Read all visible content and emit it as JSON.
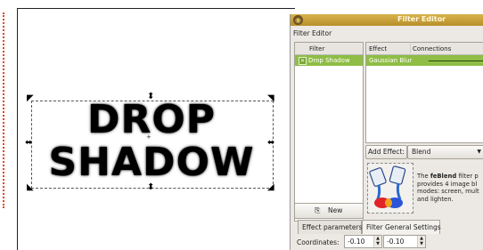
{
  "canvas": {
    "art_line1": "DROP",
    "art_line2": "SHADOW"
  },
  "dialog": {
    "title": "Filter Editor",
    "label": "Filter Editor",
    "filter_list": {
      "header": "Filter",
      "items": [
        {
          "label": "Drop Shadow",
          "checked": true
        }
      ]
    },
    "new_button": "New",
    "effect_list": {
      "col_effect": "Effect",
      "col_connections": "Connections",
      "items": [
        {
          "label": "Gaussian Blur"
        }
      ]
    },
    "add_effect_label": "Add Effect:",
    "blend_value": "Blend",
    "description": {
      "prefix": "The ",
      "bold": "feBlend",
      "line1_rest": " filter p",
      "line2": "provides 4 image bl",
      "line3": "modes: screen, mult",
      "line4": "and lighten."
    },
    "tabs": [
      {
        "label": "Effect parameters"
      },
      {
        "label": "Filter General Settings"
      }
    ],
    "coordinates_label": "Coordinates:",
    "coord_x": "-0.10",
    "coord_y": "-0.10"
  },
  "colors": {
    "selected_row": "#8fbd45",
    "titlebar": "#c9a23b",
    "guide": "#e8431f"
  }
}
